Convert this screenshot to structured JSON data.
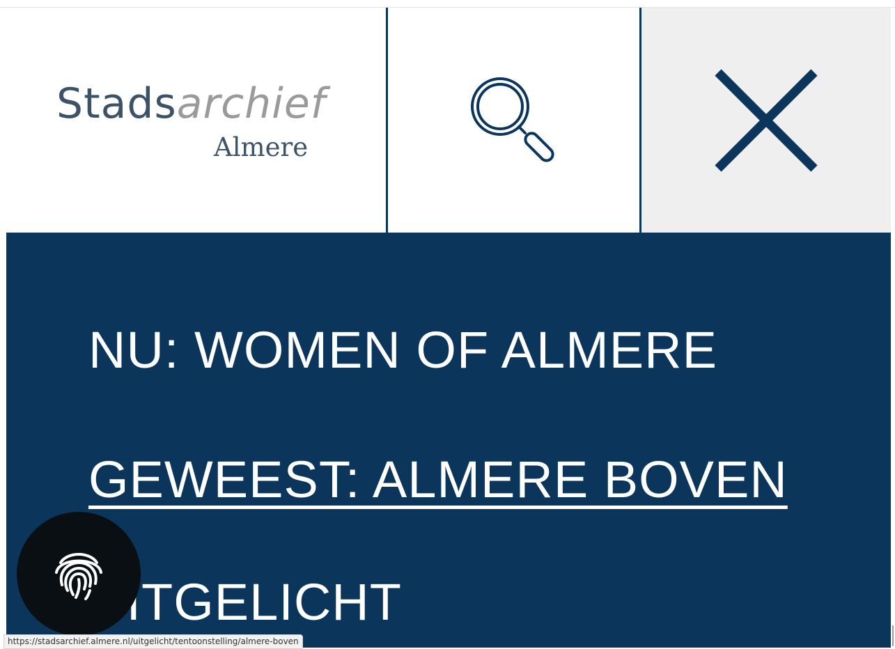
{
  "header": {
    "logo": {
      "text_primary": "Stads",
      "text_secondary": "archief",
      "subtitle": "Almere"
    },
    "search_icon": "search-icon",
    "close_icon": "close-icon"
  },
  "menu": {
    "items": [
      {
        "label": "NU: WOMEN OF ALMERE"
      },
      {
        "label": "GEWEEST: ALMERE BOVEN"
      },
      {
        "label": "UITGELICHT"
      }
    ]
  },
  "floating_button": {
    "icon": "fingerprint-icon"
  },
  "status_bar": {
    "url": "https://stadsarchief.almere.nl/uitgelicht/tentoonstelling/almere-boven"
  },
  "colors": {
    "brand_blue": "#0b355a",
    "logo_gray": "#9a9a9a",
    "close_bg": "#efefef"
  }
}
